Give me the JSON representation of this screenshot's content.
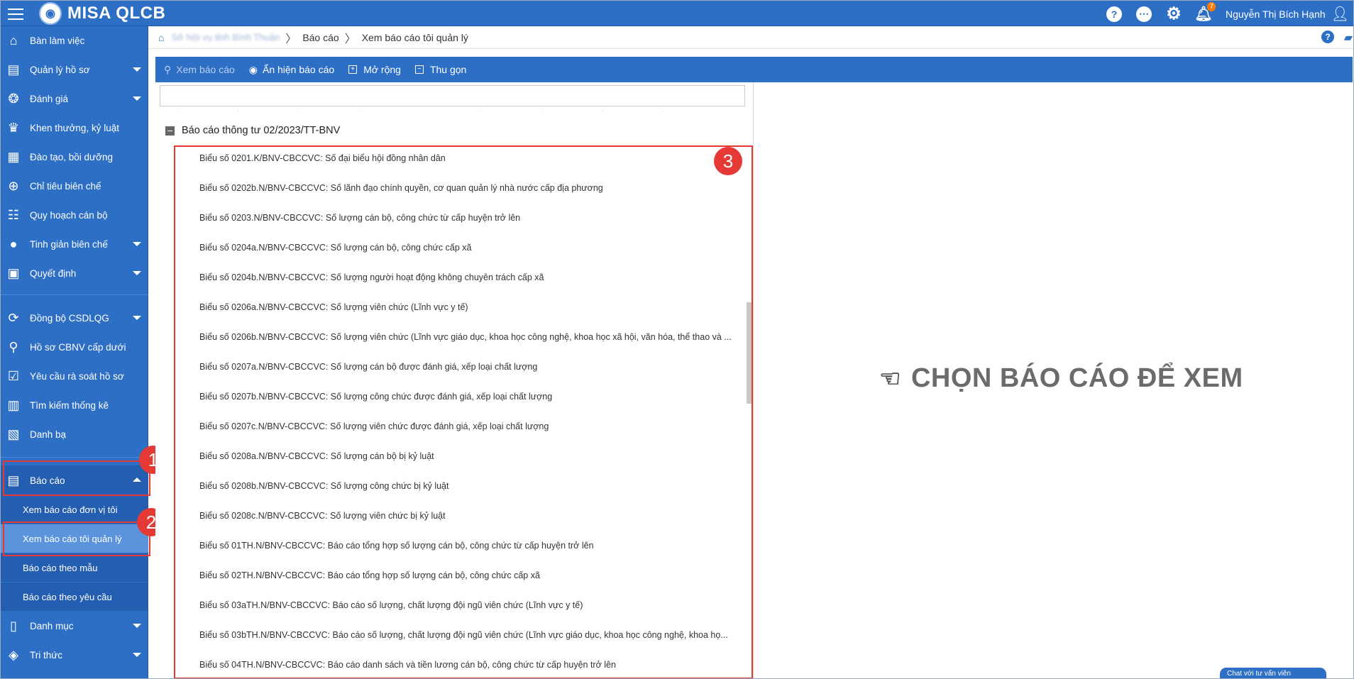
{
  "app": {
    "logo_text": "MISA QLCB",
    "notification_count": "7",
    "user_name": "Nguyễn Thị Bích Hạnh"
  },
  "sidebar": {
    "items": [
      {
        "label": "Bàn làm việc",
        "icon": "home-icon",
        "has_caret": false
      },
      {
        "label": "Quản lý hồ sơ",
        "icon": "id-card-icon",
        "has_caret": true
      },
      {
        "label": "Đánh giá",
        "icon": "medal-icon",
        "has_caret": true
      },
      {
        "label": "Khen thưởng, kỷ luật",
        "icon": "trophy-icon",
        "has_caret": false
      },
      {
        "label": "Đào tạo, bồi dưỡng",
        "icon": "training-icon",
        "has_caret": false
      },
      {
        "label": "Chỉ tiêu biên chế",
        "icon": "target-icon",
        "has_caret": false
      },
      {
        "label": "Quy hoạch cán bộ",
        "icon": "people-icon",
        "has_caret": false
      },
      {
        "label": "Tinh giản biên chế",
        "icon": "more-dots-icon",
        "has_caret": true
      },
      {
        "label": "Quyết định",
        "icon": "clipboard-icon",
        "has_caret": true
      },
      {
        "label": "Đồng bộ CSDLQG",
        "icon": "sync-icon",
        "has_caret": true
      },
      {
        "label": "Hồ sơ CBNV cấp dưới",
        "icon": "search-icon",
        "has_caret": false
      },
      {
        "label": "Yêu cầu rà soát hồ sơ",
        "icon": "review-icon",
        "has_caret": false
      },
      {
        "label": "Tìm kiếm thống kê",
        "icon": "bar-chart-icon",
        "has_caret": false
      },
      {
        "label": "Danh bạ",
        "icon": "contacts-icon",
        "has_caret": false
      },
      {
        "label": "Báo cáo",
        "icon": "report-icon",
        "has_caret": true
      },
      {
        "label": "Danh mục",
        "icon": "book-icon",
        "has_caret": true
      },
      {
        "label": "Tri thức",
        "icon": "cube-icon",
        "has_caret": true
      }
    ],
    "report_subitems": [
      {
        "label": "Xem báo cáo đơn vị tôi"
      },
      {
        "label": "Xem báo cáo tôi quản lý"
      },
      {
        "label": "Báo cáo theo mẫu"
      },
      {
        "label": "Báo cáo theo yêu cầu"
      }
    ]
  },
  "breadcrumb": {
    "root_blurred": "Sở Nội vụ tỉnh Bình Thuận",
    "level1": "Báo cáo",
    "level2": "Xem báo cáo tôi quản lý"
  },
  "toolbar": {
    "view": "Xem báo cáo",
    "toggle": "Ẩn hiện báo cáo",
    "expand": "Mở rộng",
    "collapse": "Thu gọn"
  },
  "tree": {
    "group_title": "Báo cáo thông tư 02/2023/TT-BNV",
    "reports": [
      "Biểu số 0201.K/BNV-CBCCVC: Số đại biểu hội đồng nhân dân",
      "Biểu số 0202b.N/BNV-CBCCVC: Số lãnh đạo chính quyền, cơ quan quản lý nhà nước cấp địa phương",
      "Biểu số 0203.N/BNV-CBCCVC: Số lượng cán bộ, công chức từ cấp huyện trở lên",
      "Biểu số 0204a.N/BNV-CBCCVC: Số lượng cán bộ, công chức cấp xã",
      "Biểu số 0204b.N/BNV-CBCCVC: Số lượng người hoạt động không chuyên trách cấp xã",
      "Biểu số 0206a.N/BNV-CBCCVC: Số lượng viên chức (Lĩnh vực y tế)",
      "Biểu số 0206b.N/BNV-CBCCVC: Số lượng viên chức (Lĩnh vực giáo dục, khoa học công nghệ, khoa học xã hội, văn hóa, thể thao và ...",
      "Biểu số 0207a.N/BNV-CBCCVC: Số lượng cán bộ được đánh giá, xếp loại chất lượng",
      "Biểu số 0207b.N/BNV-CBCCVC: Số lượng công chức được đánh giá, xếp loại chất lượng",
      "Biểu số 0207c.N/BNV-CBCCVC: Số lượng viên chức được đánh giá, xếp loại chất lượng",
      "Biểu số 0208a.N/BNV-CBCCVC: Số lượng cán bộ bị kỷ luật",
      "Biểu số 0208b.N/BNV-CBCCVC: Số lượng công chức bị kỷ luật",
      "Biểu số 0208c.N/BNV-CBCCVC: Số lượng viên chức bị kỷ luật",
      "Biểu số 01TH.N/BNV-CBCCVC: Báo cáo tổng hợp số lượng cán bộ, công chức từ cấp huyện trở lên",
      "Biểu số 02TH.N/BNV-CBCCVC: Báo cáo tổng hợp số lượng cán bộ, công chức cấp xã",
      "Biểu số 03aTH.N/BNV-CBCCVC: Báo cáo số lượng, chất lượng đội ngũ viên chức (Lĩnh vực y tế)",
      "Biểu số 03bTH.N/BNV-CBCCVC: Báo cáo số lượng, chất lượng đội ngũ viên chức (Lĩnh vực giáo dục, khoa học công nghệ, khoa họ...",
      "Biểu số 04TH.N/BNV-CBCCVC: Báo cáo danh sách và tiền lương cán bộ, công chức từ cấp huyện trở lên"
    ]
  },
  "main": {
    "empty_prompt": "CHỌN BÁO CÁO ĐỂ XEM"
  },
  "annotations": [
    "1",
    "2",
    "3"
  ],
  "chat_pill": "Chat với tư vấn viên",
  "colors": {
    "primary": "#2d6fc4",
    "highlight": "#e53935",
    "notification": "#ff7a00"
  }
}
